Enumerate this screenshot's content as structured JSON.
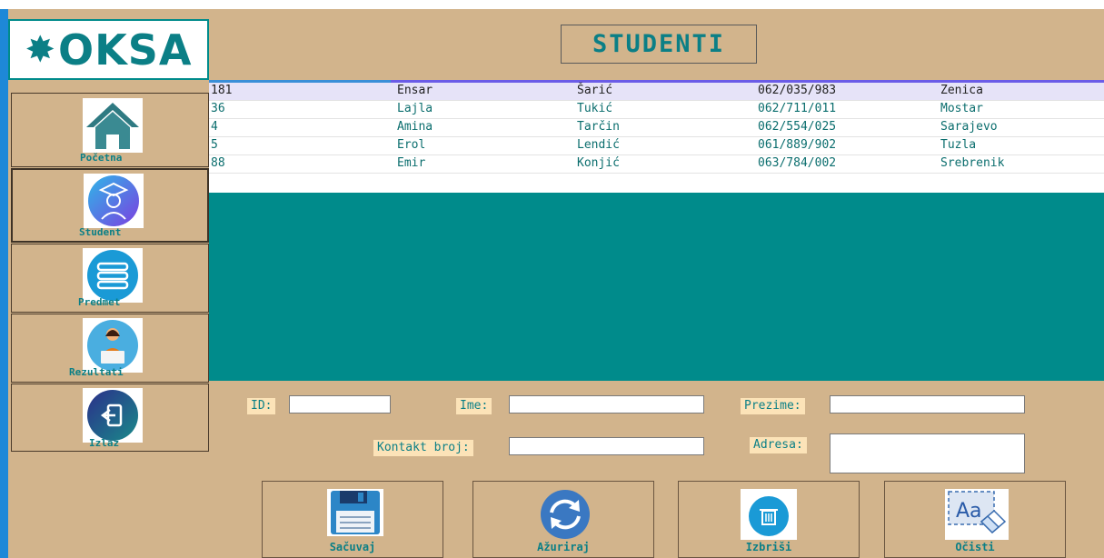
{
  "logo": {
    "text": "OKSA",
    "star": "✸"
  },
  "page_title": "STUDENTI",
  "nav": [
    {
      "label": "Početna",
      "icon": "home-icon"
    },
    {
      "label": "Student",
      "icon": "graduate-icon"
    },
    {
      "label": "Predmet",
      "icon": "books-icon"
    },
    {
      "label": "Rezultati",
      "icon": "person-laptop-icon"
    },
    {
      "label": "Izlaz",
      "icon": "logout-icon"
    }
  ],
  "grid": {
    "rows": [
      [
        "181",
        "Ensar",
        "Šarić",
        "062/035/983",
        "Zenica"
      ],
      [
        "36",
        "Lajla",
        "Tukić",
        "062/711/011",
        "Mostar"
      ],
      [
        "4",
        "Amina",
        "Tarčin",
        "062/554/025",
        "Sarajevo"
      ],
      [
        "5",
        "Erol",
        "Lendić",
        "061/889/902",
        "Tuzla"
      ],
      [
        "88",
        "Emir",
        "Konjić",
        "063/784/002",
        "Srebrenik"
      ]
    ]
  },
  "form": {
    "id_label": "ID:",
    "ime_label": "Ime:",
    "prezime_label": "Prezime:",
    "kontakt_label": "Kontakt broj:",
    "adresa_label": "Adresa:",
    "id_value": "",
    "ime_value": "",
    "prezime_value": "",
    "kontakt_value": "",
    "adresa_value": ""
  },
  "actions": [
    {
      "label": "Sačuvaj",
      "icon": "floppy-disk-icon"
    },
    {
      "label": "Ažuriraj",
      "icon": "refresh-icon"
    },
    {
      "label": "Izbriši",
      "icon": "trash-icon"
    },
    {
      "label": "Očisti",
      "icon": "clear-text-icon"
    }
  ],
  "colors": {
    "background": "#d2b48c",
    "accent": "#008b8b",
    "label_bg": "#fce3b8",
    "sidebar_edge": "#1e88d8"
  }
}
